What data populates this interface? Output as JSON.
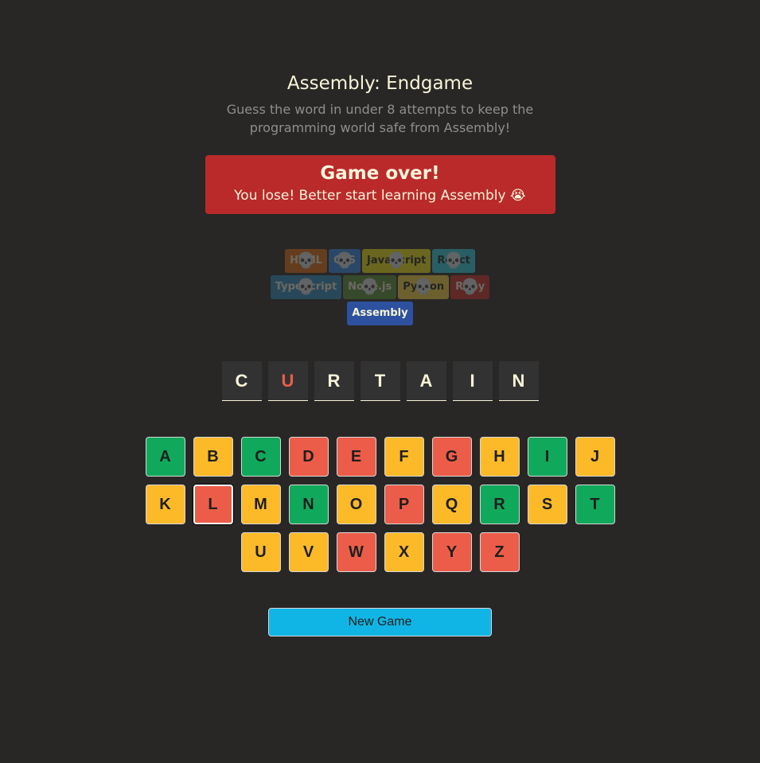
{
  "header": {
    "title": "Assembly: Endgame",
    "subtitle": "Guess the word in under 8 attempts to keep the programming world safe from Assembly!"
  },
  "status": {
    "heading": "Game over!",
    "message": "You lose! Better start learning Assembly 😭"
  },
  "languages": [
    {
      "name": "HTML",
      "bg": "#E2680F",
      "color": "#F9F4DA",
      "lost": true
    },
    {
      "name": "CSS",
      "bg": "#328AF1",
      "color": "#F9F4DA",
      "lost": true
    },
    {
      "name": "JavaScript",
      "bg": "#F4EB13",
      "color": "#1E1E1E",
      "lost": true
    },
    {
      "name": "React",
      "bg": "#2ED3E9",
      "color": "#1E1E1E",
      "lost": true
    },
    {
      "name": "TypeScript",
      "bg": "#298EC6",
      "color": "#F9F4DA",
      "lost": true
    },
    {
      "name": "Node.js",
      "bg": "#599137",
      "color": "#F9F4DA",
      "lost": true
    },
    {
      "name": "Python",
      "bg": "#FFD742",
      "color": "#1E1E1E",
      "lost": true
    },
    {
      "name": "Ruby",
      "bg": "#D02B2B",
      "color": "#F9F4DA",
      "lost": true
    },
    {
      "name": "Assembly",
      "bg": "#2D519F",
      "color": "#F9F4DA",
      "lost": false
    }
  ],
  "skull_icon": "💀",
  "word": [
    {
      "letter": "C",
      "missed": false
    },
    {
      "letter": "U",
      "missed": true
    },
    {
      "letter": "R",
      "missed": false
    },
    {
      "letter": "T",
      "missed": false
    },
    {
      "letter": "A",
      "missed": false
    },
    {
      "letter": "I",
      "missed": false
    },
    {
      "letter": "N",
      "missed": false
    }
  ],
  "keyboard": [
    {
      "letter": "A",
      "state": "correct"
    },
    {
      "letter": "B",
      "state": "unused"
    },
    {
      "letter": "C",
      "state": "correct"
    },
    {
      "letter": "D",
      "state": "wrong"
    },
    {
      "letter": "E",
      "state": "wrong"
    },
    {
      "letter": "F",
      "state": "unused"
    },
    {
      "letter": "G",
      "state": "wrong"
    },
    {
      "letter": "H",
      "state": "unused"
    },
    {
      "letter": "I",
      "state": "correct"
    },
    {
      "letter": "J",
      "state": "unused"
    },
    {
      "letter": "K",
      "state": "unused"
    },
    {
      "letter": "L",
      "state": "wrong",
      "last": true
    },
    {
      "letter": "M",
      "state": "unused"
    },
    {
      "letter": "N",
      "state": "correct"
    },
    {
      "letter": "O",
      "state": "unused"
    },
    {
      "letter": "P",
      "state": "wrong"
    },
    {
      "letter": "Q",
      "state": "unused"
    },
    {
      "letter": "R",
      "state": "correct"
    },
    {
      "letter": "S",
      "state": "unused"
    },
    {
      "letter": "T",
      "state": "correct"
    },
    {
      "letter": "U",
      "state": "unused"
    },
    {
      "letter": "V",
      "state": "unused"
    },
    {
      "letter": "W",
      "state": "wrong"
    },
    {
      "letter": "X",
      "state": "unused"
    },
    {
      "letter": "Y",
      "state": "wrong"
    },
    {
      "letter": "Z",
      "state": "wrong"
    }
  ],
  "new_game_label": "New Game"
}
